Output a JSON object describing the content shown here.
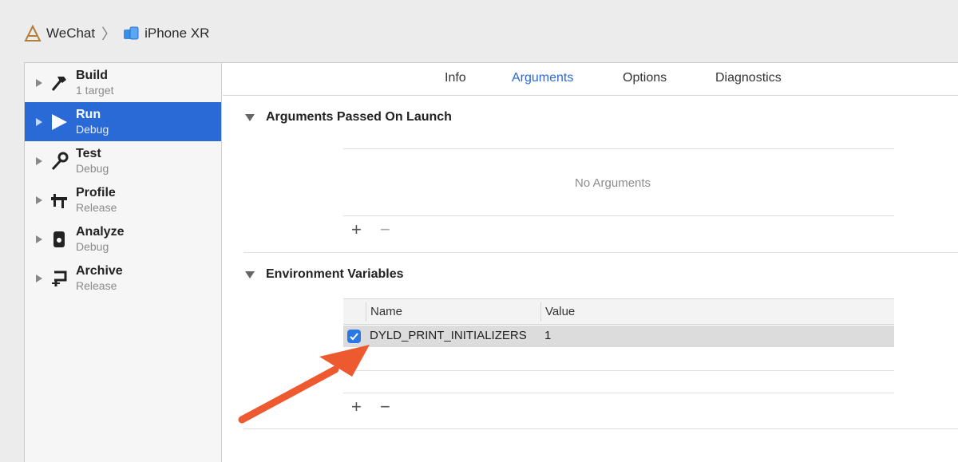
{
  "breadcrumb": {
    "project": "WeChat",
    "device": "iPhone XR"
  },
  "sidebar": {
    "items": [
      {
        "title": "Build",
        "subtitle": "1 target",
        "icon": "hammer-icon"
      },
      {
        "title": "Run",
        "subtitle": "Debug",
        "icon": "play-icon"
      },
      {
        "title": "Test",
        "subtitle": "Debug",
        "icon": "wrench-icon"
      },
      {
        "title": "Profile",
        "subtitle": "Release",
        "icon": "gauge-icon"
      },
      {
        "title": "Analyze",
        "subtitle": "Debug",
        "icon": "analyze-icon"
      },
      {
        "title": "Archive",
        "subtitle": "Release",
        "icon": "archive-icon"
      }
    ],
    "active_index": 1
  },
  "tabs": [
    "Info",
    "Arguments",
    "Options",
    "Diagnostics"
  ],
  "active_tab": "Arguments",
  "arguments_section": {
    "title": "Arguments Passed On Launch",
    "empty_text": "No Arguments",
    "add": "+",
    "remove": "−"
  },
  "env_section": {
    "title": "Environment Variables",
    "columns": [
      "Name",
      "Value"
    ],
    "rows": [
      {
        "enabled": true,
        "name": "DYLD_PRINT_INITIALIZERS",
        "value": "1"
      }
    ],
    "add": "+",
    "remove": "−"
  },
  "colors": {
    "accent": "#2a6ad6",
    "annotation_arrow": "#ee5a2f"
  }
}
